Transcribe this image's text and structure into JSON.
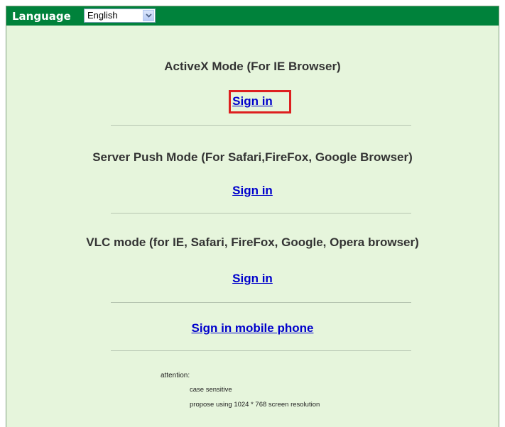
{
  "language": {
    "label": "Language",
    "selected": "English"
  },
  "modes": [
    {
      "title": "ActiveX Mode (For IE Browser)",
      "signin_label": "Sign in"
    },
    {
      "title": "Server Push Mode (For Safari,FireFox, Google Browser)",
      "signin_label": "Sign in"
    },
    {
      "title": "VLC mode (for IE, Safari, FireFox, Google, Opera browser)",
      "signin_label": "Sign in"
    }
  ],
  "mobile": {
    "signin_label": "Sign in mobile phone"
  },
  "attention": {
    "label": "attention:",
    "notes": [
      "case sensitive",
      "propose using 1024 * 768 screen resolution"
    ]
  },
  "colors": {
    "topbar": "#00823b",
    "background": "#e6f5dc",
    "link": "#0000cc",
    "highlight": "#dd1f1f"
  }
}
